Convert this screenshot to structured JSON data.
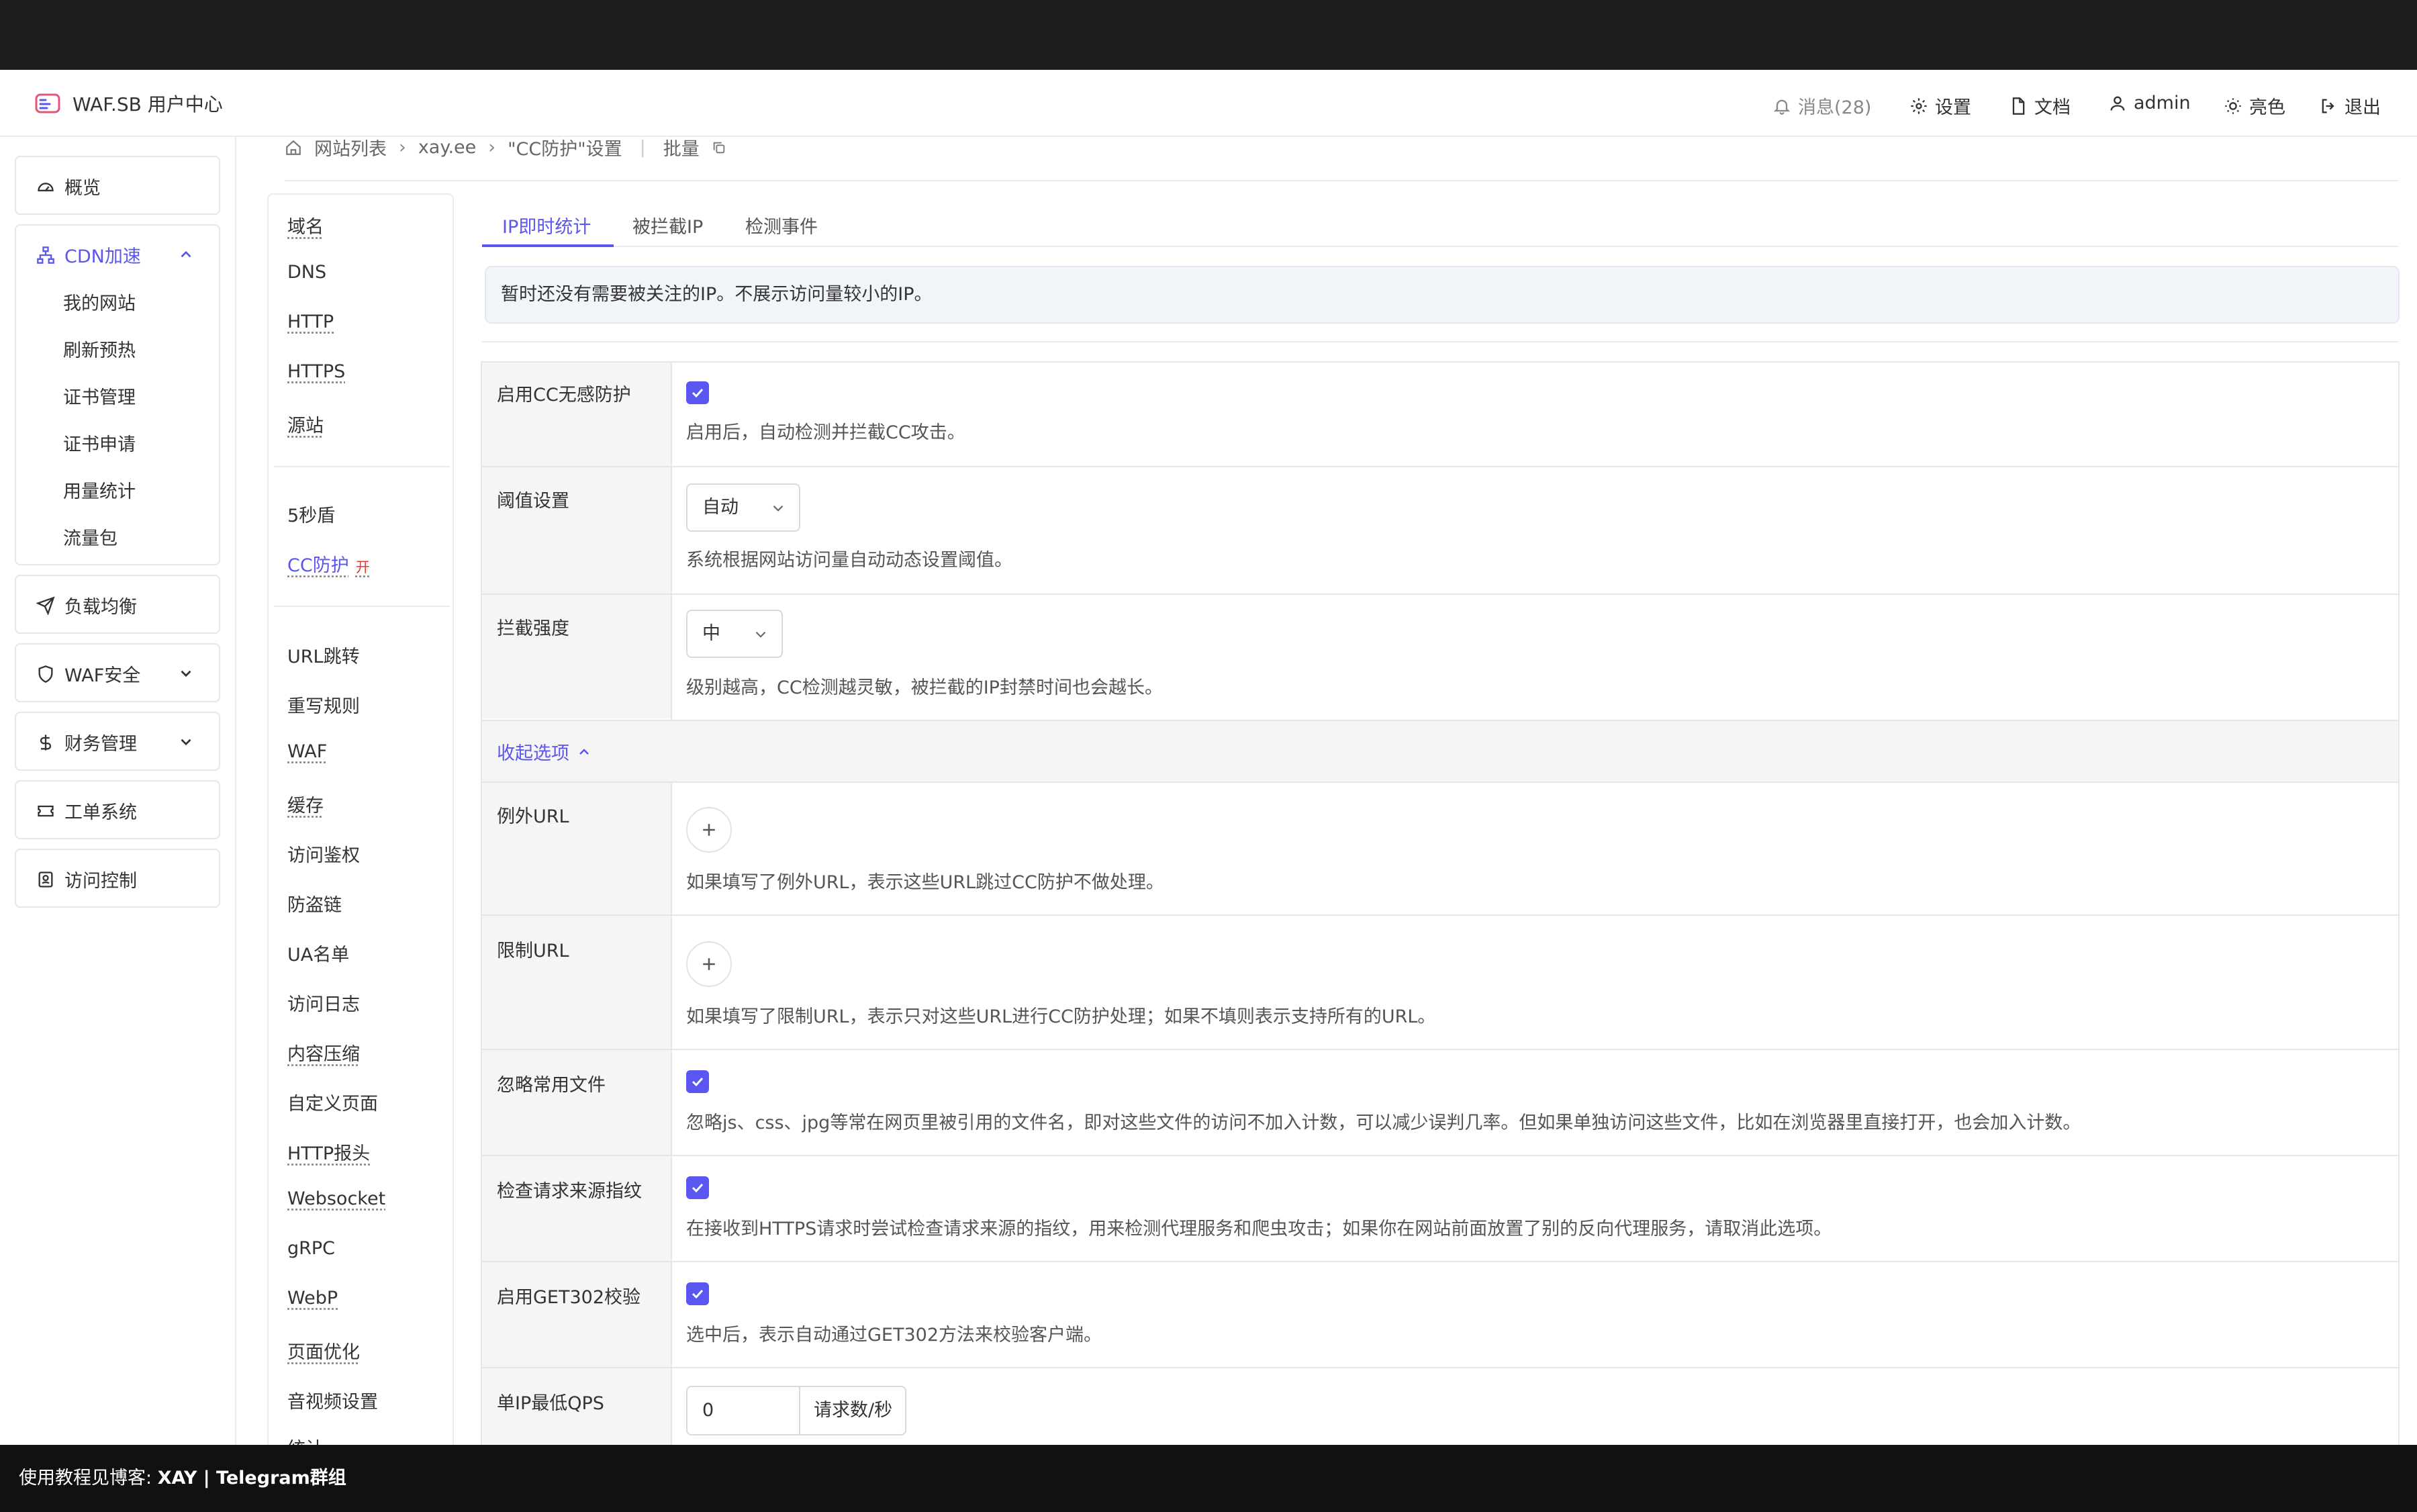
{
  "brand": {
    "title": "WAF.SB 用户中心",
    "accent": "#5b56f0"
  },
  "header": {
    "messages": "消息(28)",
    "settings": "设置",
    "docs": "文档",
    "user": "admin",
    "theme": "亮色",
    "logout": "退出"
  },
  "sidebar": {
    "overview": "概览",
    "cdn": {
      "label": "CDN加速",
      "items": [
        "我的网站",
        "刷新预热",
        "证书管理",
        "证书申请",
        "用量统计",
        "流量包"
      ]
    },
    "lb": "负载均衡",
    "waf": "WAF安全",
    "finance": "财务管理",
    "ticket": "工单系统",
    "access": "访问控制"
  },
  "breadcrumb": {
    "sites": "网站列表",
    "domain": "xay.ee",
    "page": "\"CC防护\"设置",
    "batch": "批量"
  },
  "site_menu": {
    "group1": [
      "域名",
      "DNS",
      "HTTP",
      "HTTPS",
      "源站"
    ],
    "group2": [
      "5秒盾",
      "CC防护"
    ],
    "cc_tag": "开",
    "group3": [
      "URL跳转",
      "重写规则",
      "WAF",
      "缓存",
      "访问鉴权",
      "防盗链",
      "UA名单",
      "访问日志",
      "内容压缩",
      "自定义页面",
      "HTTP报头",
      "Websocket",
      "gRPC",
      "WebP",
      "页面优化",
      "音视频设置",
      "统计"
    ]
  },
  "tabs": [
    "IP即时统计",
    "被拦截IP",
    "检测事件"
  ],
  "notice": "暂时还没有需要被关注的IP。不展示访问量较小的IP。",
  "form": {
    "cc_enable": {
      "label": "启用CC无感防护",
      "checked": true,
      "desc": "启用后，自动检测并拦截CC攻击。"
    },
    "threshold": {
      "label": "阈值设置",
      "value": "自动",
      "desc": "系统根据网站访问量自动动态设置阈值。"
    },
    "strength": {
      "label": "拦截强度",
      "value": "中",
      "desc": "级别越高，CC检测越灵敏，被拦截的IP封禁时间也会越长。"
    },
    "collapse": "收起选项",
    "except_url": {
      "label": "例外URL",
      "desc": "如果填写了例外URL，表示这些URL跳过CC防护不做处理。"
    },
    "limit_url": {
      "label": "限制URL",
      "desc": "如果填写了限制URL，表示只对这些URL进行CC防护处理；如果不填则表示支持所有的URL。"
    },
    "ignore_files": {
      "label": "忽略常用文件",
      "checked": true,
      "desc": "忽略js、css、jpg等常在网页里被引用的文件名，即对这些文件的访问不加入计数，可以减少误判几率。但如果单独访问这些文件，比如在浏览器里直接打开，也会加入计数。"
    },
    "fingerprint": {
      "label": "检查请求来源指纹",
      "checked": true,
      "desc": "在接收到HTTPS请求时尝试检查请求来源的指纹，用来检测代理服务和爬虫攻击；如果你在网站前面放置了别的反向代理服务，请取消此选项。"
    },
    "get302": {
      "label": "启用GET302校验",
      "checked": true,
      "desc": "选中后，表示自动通过GET302方法来校验客户端。"
    },
    "min_qps": {
      "label": "单IP最低QPS",
      "value": "0",
      "unit": "请求数/秒"
    }
  },
  "footer": {
    "prefix": "使用教程见博客: ",
    "links": "XAY | Telegram群组"
  }
}
